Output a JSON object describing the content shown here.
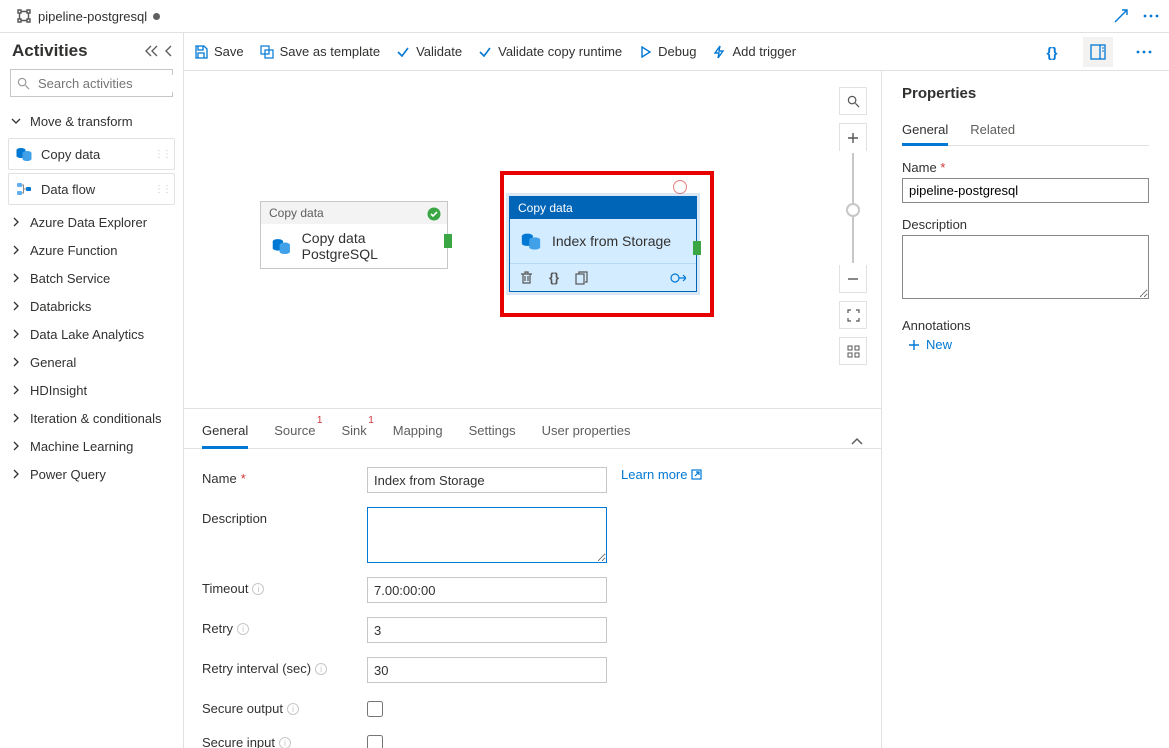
{
  "file_tab": {
    "label": "pipeline-postgresql",
    "dirty": true
  },
  "sidebar": {
    "title": "Activities",
    "search_placeholder": "Search activities",
    "groups": [
      {
        "label": "Move & transform",
        "expanded": true
      },
      {
        "label": "Azure Data Explorer"
      },
      {
        "label": "Azure Function"
      },
      {
        "label": "Batch Service"
      },
      {
        "label": "Databricks"
      },
      {
        "label": "Data Lake Analytics"
      },
      {
        "label": "General"
      },
      {
        "label": "HDInsight"
      },
      {
        "label": "Iteration & conditionals"
      },
      {
        "label": "Machine Learning"
      },
      {
        "label": "Power Query"
      }
    ],
    "items": [
      {
        "label": "Copy data"
      },
      {
        "label": "Data flow"
      }
    ]
  },
  "toolbar": {
    "save": "Save",
    "save_template": "Save as template",
    "validate": "Validate",
    "validate_runtime": "Validate copy runtime",
    "debug": "Debug",
    "add_trigger": "Add trigger"
  },
  "canvas": {
    "nodes": [
      {
        "type": "Copy data",
        "name": "Copy data PostgreSQL",
        "status": "ok"
      },
      {
        "type": "Copy data",
        "name": "Index from Storage",
        "selected": true,
        "status": "warn"
      }
    ]
  },
  "details": {
    "tabs": [
      {
        "label": "General",
        "active": true
      },
      {
        "label": "Source",
        "err": "1"
      },
      {
        "label": "Sink",
        "err": "1"
      },
      {
        "label": "Mapping"
      },
      {
        "label": "Settings"
      },
      {
        "label": "User properties"
      }
    ],
    "learn_more": "Learn more",
    "fields": {
      "name_label": "Name",
      "name": "Index from Storage",
      "desc_label": "Description",
      "desc": "",
      "timeout_label": "Timeout",
      "timeout": "7.00:00:00",
      "retry_label": "Retry",
      "retry": "3",
      "retry_int_label": "Retry interval (sec)",
      "retry_int": "30",
      "secure_out_label": "Secure output",
      "secure_in_label": "Secure input"
    }
  },
  "properties": {
    "header": "Properties",
    "tabs": [
      {
        "label": "General",
        "active": true
      },
      {
        "label": "Related"
      }
    ],
    "name_label": "Name",
    "name": "pipeline-postgresql",
    "desc_label": "Description",
    "ann_label": "Annotations",
    "new": "New"
  }
}
